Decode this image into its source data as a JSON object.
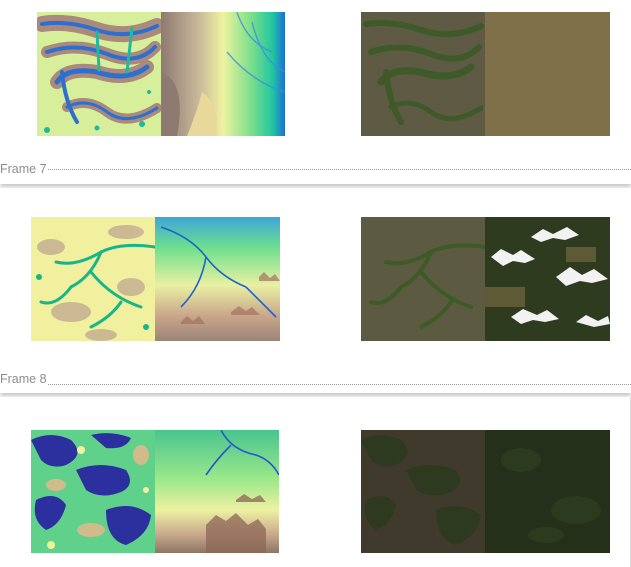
{
  "frames": [
    {
      "label": ""
    },
    {
      "label": "Frame 7"
    },
    {
      "label": "Frame 8"
    }
  ]
}
